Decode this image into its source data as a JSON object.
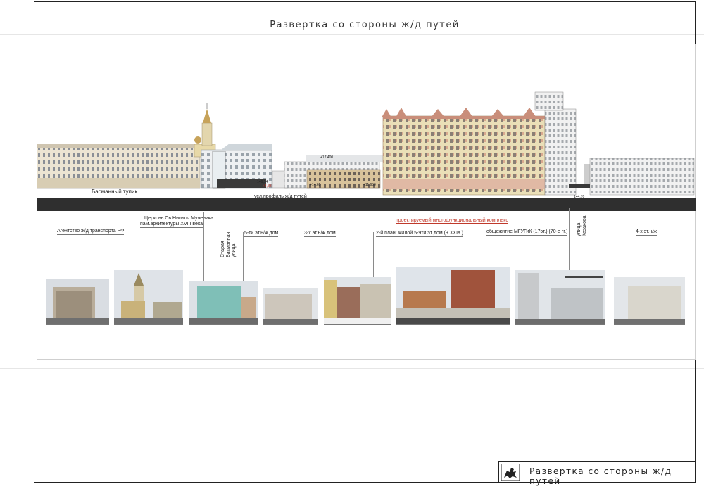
{
  "sheet": {
    "title": "Развертка со стороны ж/д путей",
    "stamp_title": "Развертка со стороны ж/д путей"
  },
  "elevation": {
    "street_label": "Басманный тупик",
    "profile_label": "усл.профиль ж/д путей",
    "marks": [
      "+17,400",
      "+14,65",
      "+11,650",
      "144,70",
      "146,14",
      "+4,33"
    ]
  },
  "labels": {
    "agency": "Агентство ж/д транспорта РФ",
    "church_line1": "Церковь Св.Никиты Мученика",
    "church_line2": "пам.архитектуры XVIII века",
    "street1": "Старая\nБасманная\nулица",
    "house5": "5-ти эт.н/ж дом",
    "house3": "3-х эт.н/ж дом",
    "complex": "проектируемый многофункциональный комплекс",
    "plan2": "2-й план: жилой 5-9ти эт дом (н.XXIв.)",
    "dorm": "общежитие МГУГиК (17эт.) (70-е гг.)",
    "street2": "улица\nКазакова",
    "house4": "4-х эт.н/ж"
  },
  "colors": {
    "ground": "#2f2f2f",
    "accent_red": "#c0392b",
    "complex_facade": "#e8dcb0",
    "complex_roof": "#c98e7a"
  }
}
